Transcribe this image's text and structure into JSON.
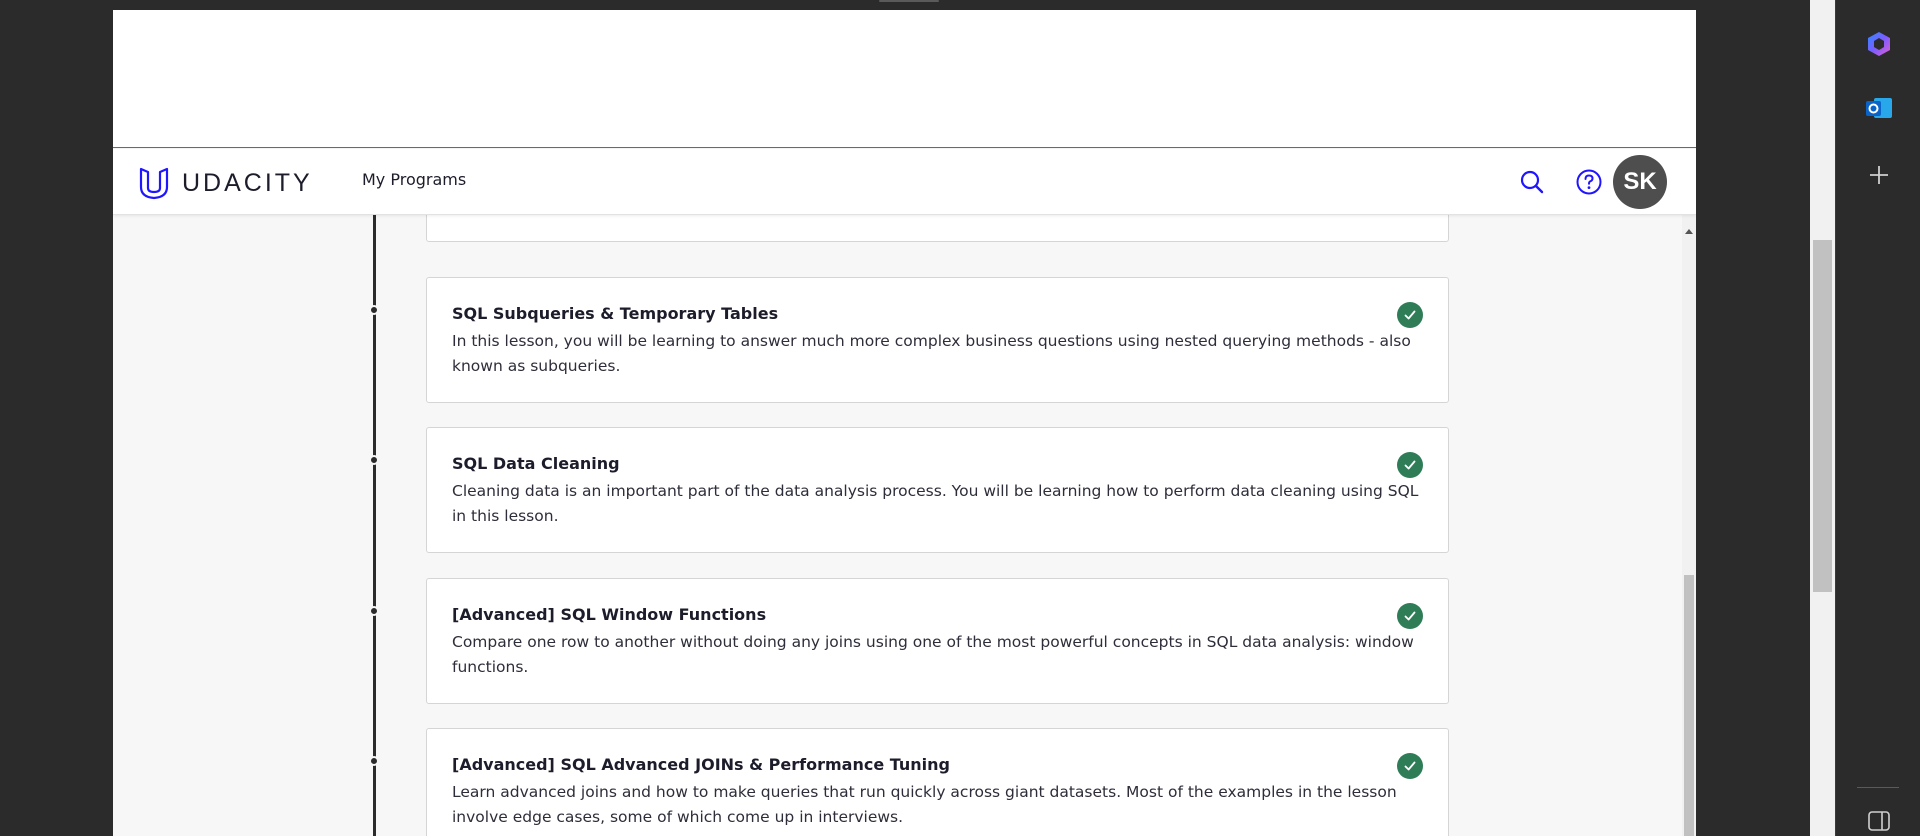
{
  "header": {
    "logo_text": "UDACITY",
    "nav_link": "My Programs",
    "avatar_initials": "SK"
  },
  "lessons": [
    {
      "title": "SQL Subqueries & Temporary Tables",
      "description": "In this lesson, you will be learning to answer much more complex business questions using nested querying methods - also known as subqueries.",
      "completed": true
    },
    {
      "title": "SQL Data Cleaning",
      "description": "Cleaning data is an important part of the data analysis process. You will be learning how to perform data cleaning using SQL in this lesson.",
      "completed": true
    },
    {
      "title": "[Advanced] SQL Window Functions",
      "description": "Compare one row to another without doing any joins using one of the most powerful concepts in SQL data analysis: window functions.",
      "completed": true
    },
    {
      "title": "[Advanced] SQL Advanced JOINs & Performance Tuning",
      "description": "Learn advanced joins and how to make queries that run quickly across giant datasets. Most of the examples in the lesson involve edge cases, some of which come up in interviews.",
      "completed": true
    }
  ],
  "icons": {
    "search": "search-icon",
    "help": "help-icon",
    "check": "check-icon",
    "sidebar": [
      "copilot-icon",
      "outlook-icon",
      "plus-icon",
      "sidebar-toggle-icon"
    ]
  },
  "colors": {
    "brand": "#2015ff",
    "check": "#2f7d57",
    "avatar": "#4e4e4e"
  }
}
